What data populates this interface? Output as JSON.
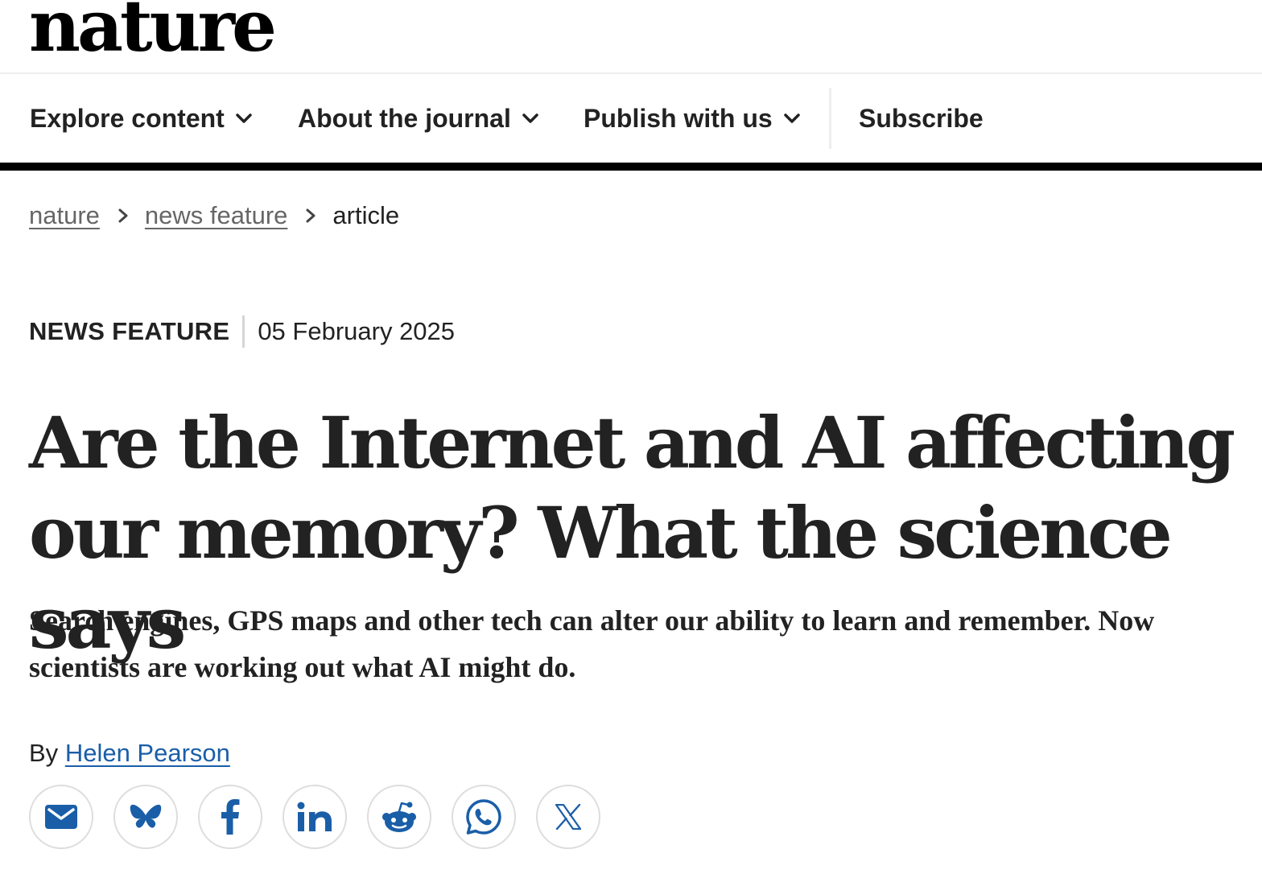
{
  "site": {
    "logo_text": "nature"
  },
  "nav": {
    "items": [
      {
        "label": "Explore content",
        "has_dropdown": true
      },
      {
        "label": "About the journal",
        "has_dropdown": true
      },
      {
        "label": "Publish with us",
        "has_dropdown": true
      },
      {
        "label": "Subscribe",
        "has_dropdown": false
      }
    ]
  },
  "breadcrumb": {
    "items": [
      "nature",
      "news feature"
    ],
    "current": "article"
  },
  "article": {
    "type": "NEWS FEATURE",
    "date": "05 February 2025",
    "title": "Are the Internet and AI affecting our memory? What the science says",
    "standfirst": "Search engines, GPS maps and other tech can alter our ability to learn and remember. Now scientists are working out what AI might do.",
    "byline_prefix": "By",
    "author": "Helen Pearson"
  },
  "share": {
    "icons": [
      "email-icon",
      "bluesky-icon",
      "facebook-icon",
      "linkedin-icon",
      "reddit-icon",
      "whatsapp-icon",
      "x-icon"
    ]
  },
  "colors": {
    "text": "#222222",
    "link": "#1a5ea8",
    "icon": "#1a5ea8",
    "muted": "#666666",
    "rule": "#000000"
  }
}
